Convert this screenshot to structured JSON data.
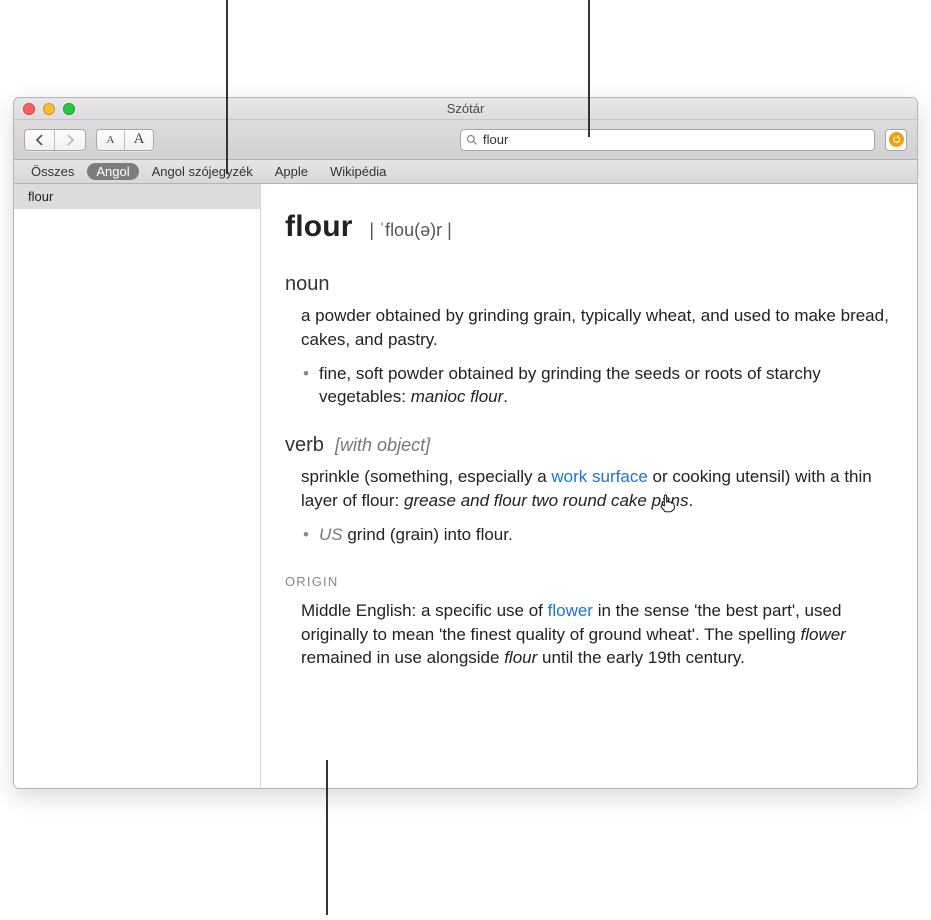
{
  "window": {
    "title": "Szótár"
  },
  "toolbar": {
    "font_small": "A",
    "font_large": "A"
  },
  "search": {
    "value": "flour"
  },
  "sources": {
    "items": [
      {
        "label": "Összes",
        "active": false
      },
      {
        "label": "Angol",
        "active": true
      },
      {
        "label": "Angol szójegyzék",
        "active": false
      },
      {
        "label": "Apple",
        "active": false
      },
      {
        "label": "Wikipédia",
        "active": false
      }
    ]
  },
  "sidebar": {
    "items": [
      {
        "label": "flour",
        "selected": true
      }
    ]
  },
  "entry": {
    "headword": "flour",
    "pronunciation": "| ˈflou(ə)r |",
    "noun_label": "noun",
    "noun_def": "a powder obtained by grinding grain, typically wheat, and used to make bread, cakes, and pastry.",
    "noun_sub_pre": "fine, soft powder obtained by grinding the seeds or roots of starchy vegetables: ",
    "noun_sub_example": "manioc flour",
    "noun_sub_post": ".",
    "verb_label": "verb",
    "verb_note": "[with object]",
    "verb_def_pre": "sprinkle (something, especially a ",
    "verb_xref": "work surface",
    "verb_def_mid": " or cooking utensil) with a thin layer of flour: ",
    "verb_example": "grease and flour two round cake pans",
    "verb_def_post": ".",
    "verb_sub_region": "US",
    "verb_sub_text": " grind (grain) into flour.",
    "origin_label": "ORIGIN",
    "origin_pre": "Middle English: a specific use of ",
    "origin_xref": "flower",
    "origin_mid": " in the sense 'the best part', used originally to mean 'the finest quality of ground wheat'. The spelling ",
    "origin_ital1": "flower",
    "origin_mid2": " remained in use alongside ",
    "origin_ital2": "flour",
    "origin_post": " until the early 19th century."
  }
}
